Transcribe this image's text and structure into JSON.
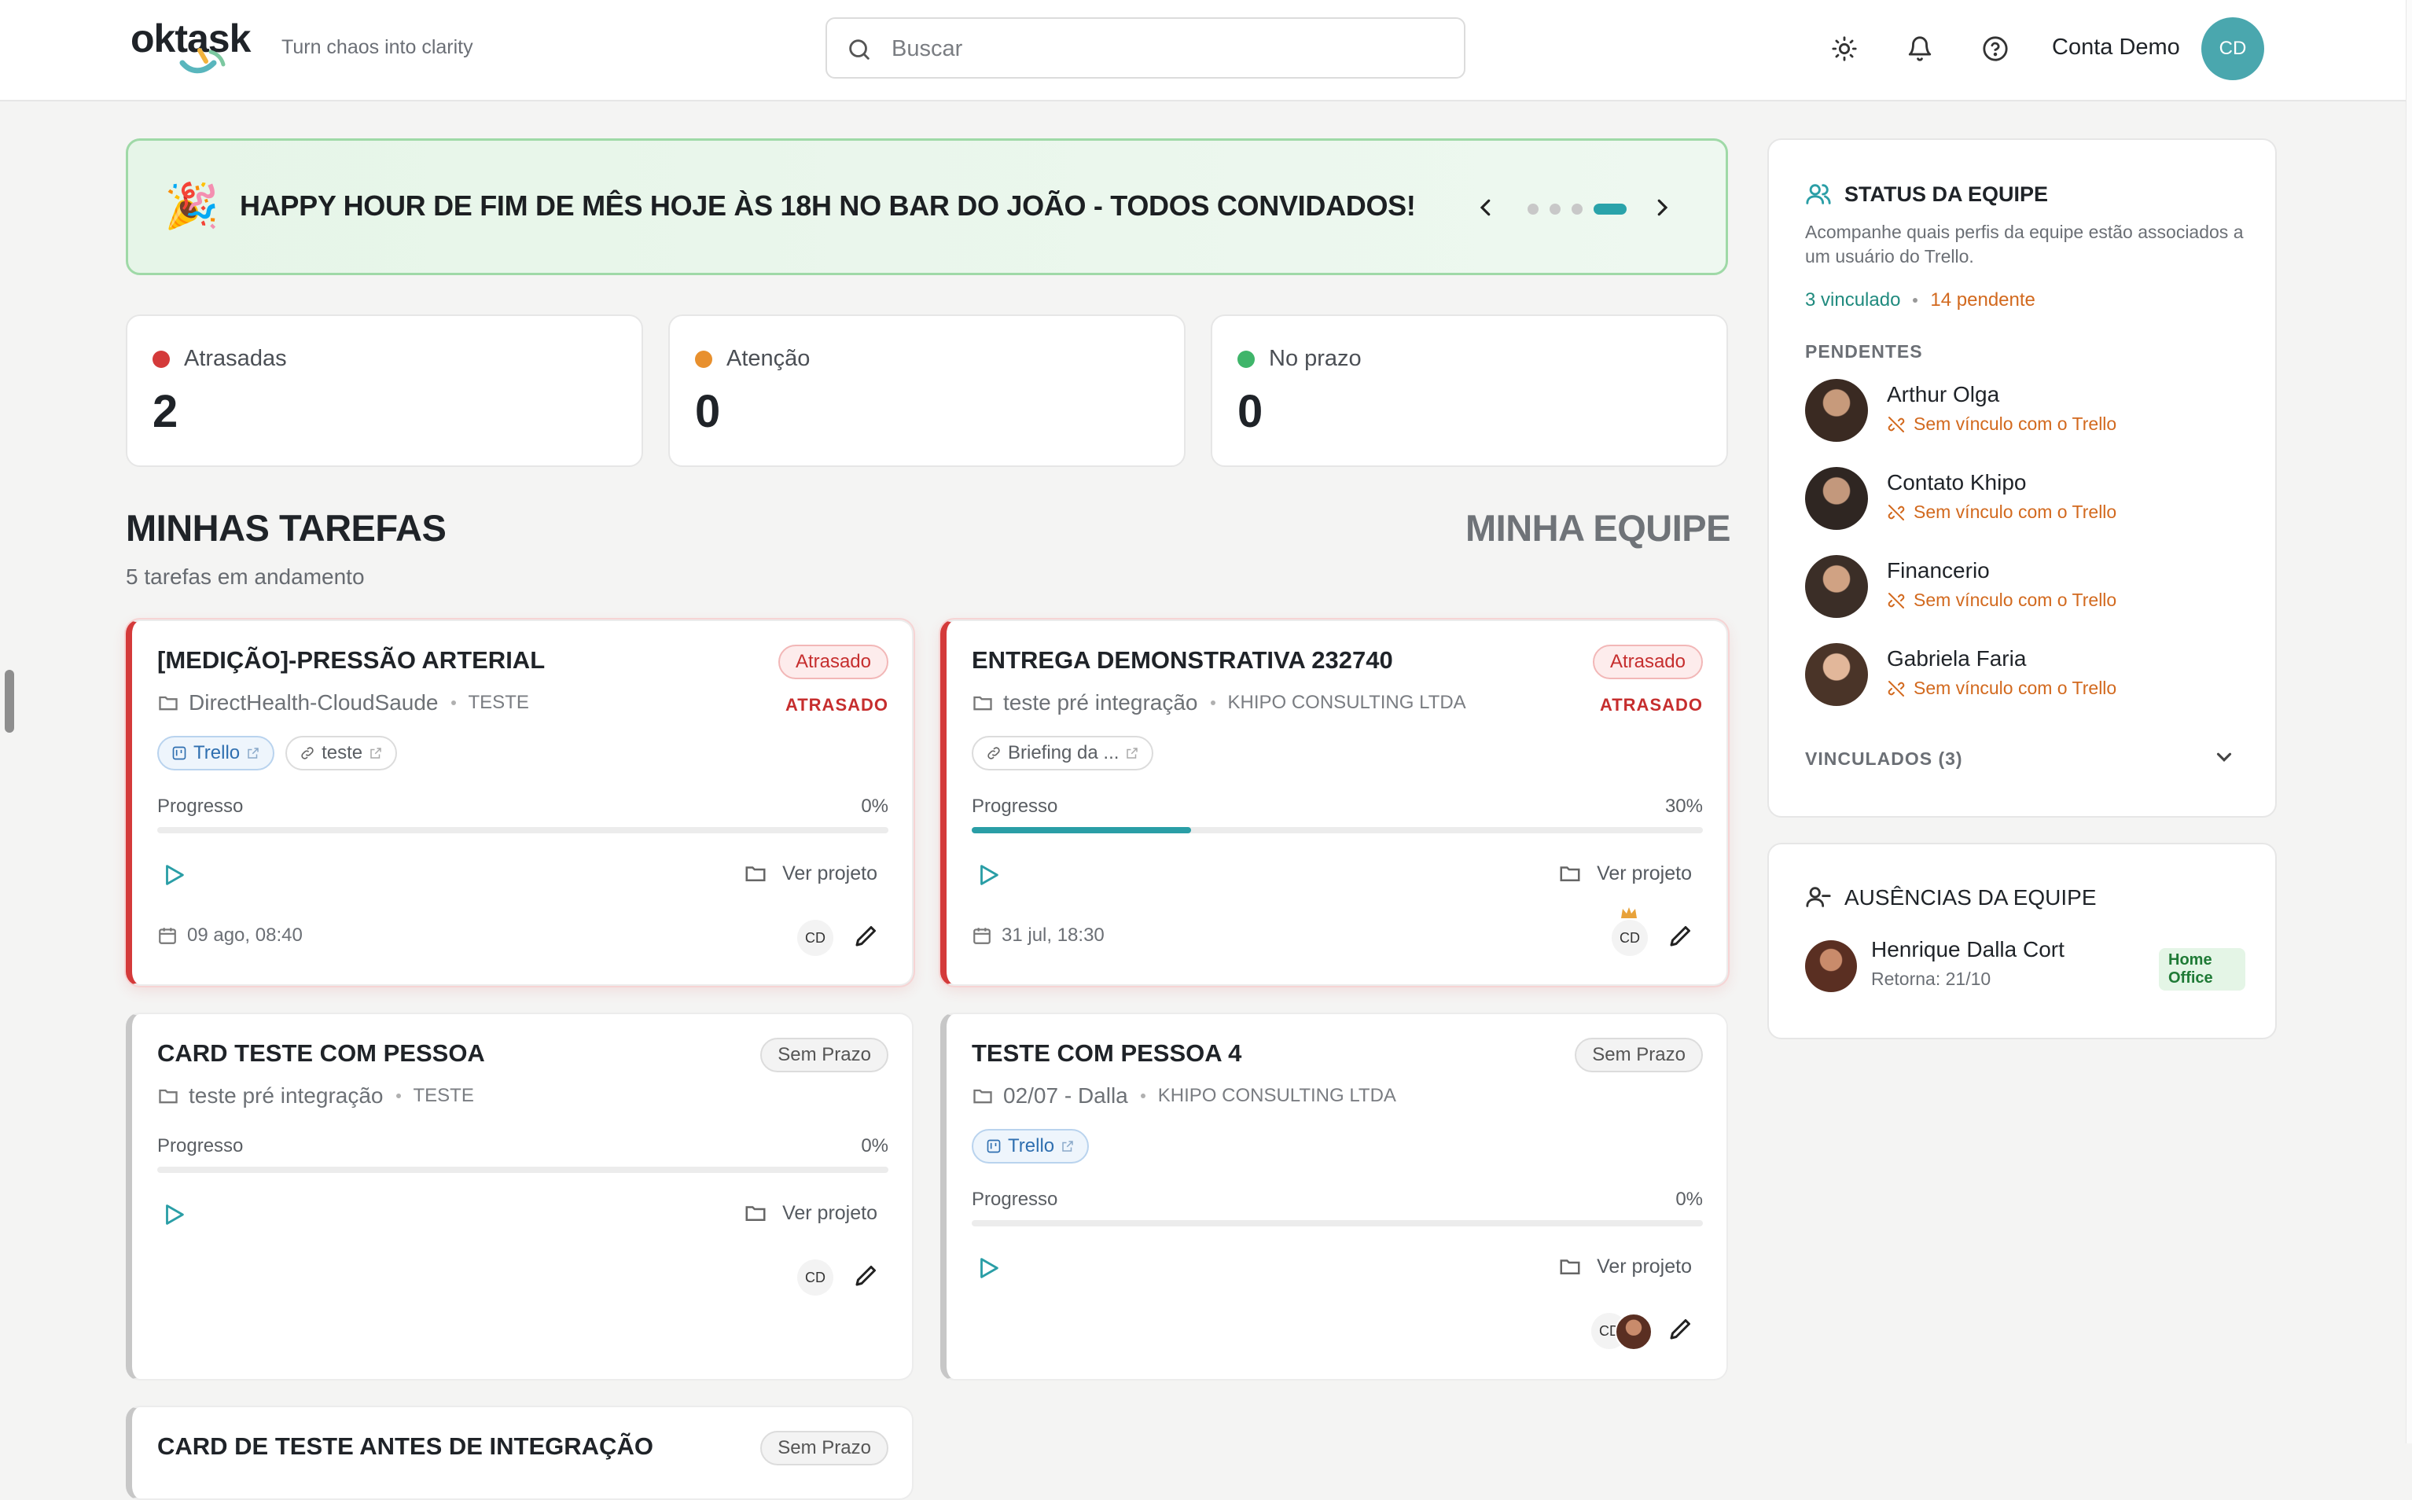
{
  "header": {
    "logo": "oktask",
    "tagline": "Turn chaos into clarity",
    "search_placeholder": "Buscar",
    "account_name": "Conta Demo",
    "account_initials": "CD",
    "icons": [
      "sun-icon",
      "bell-icon",
      "help-circle-icon"
    ]
  },
  "banner": {
    "emoji": "🎉",
    "message": "HAPPY HOUR DE FIM DE MÊS HOJE ÀS 18H NO BAR DO JOÃO - TODOS CONVIDADOS!",
    "slide_count": 4,
    "active_slide": 4
  },
  "stats": [
    {
      "label": "Atrasadas",
      "value": "2",
      "color": "#d43a3a"
    },
    {
      "label": "Atenção",
      "value": "0",
      "color": "#e8902e"
    },
    {
      "label": "No prazo",
      "value": "0",
      "color": "#3fb56a"
    }
  ],
  "tasks_section": {
    "title": "MINHAS TAREFAS",
    "subtitle": "5 tarefas em andamento",
    "team_tab": "MINHA EQUIPE"
  },
  "tasks": [
    {
      "title": "[MEDIÇÃO]-PRESSÃO ARTERIAL",
      "badge": "Atrasado",
      "late_caption": "ATRASADO",
      "project": "DirectHealth-CloudSaude",
      "client": "TESTE",
      "chips": [
        "Trello",
        "teste"
      ],
      "progress_label": "Progresso",
      "progress_text": "0%",
      "progress": 0,
      "action_label": "Ver projeto",
      "date": "09 ago, 08:40",
      "assignee": "CD"
    },
    {
      "title": "ENTREGA DEMONSTRATIVA 232740",
      "badge": "Atrasado",
      "late_caption": "ATRASADO",
      "project": "teste pré integração",
      "client": "KHIPO CONSULTING LTDA",
      "chips": [
        "Briefing da ..."
      ],
      "progress_label": "Progresso",
      "progress_text": "30%",
      "progress": 30,
      "action_label": "Ver projeto",
      "date": "31 jul, 18:30",
      "assignee": "CD"
    },
    {
      "title": "CARD TESTE COM PESSOA",
      "badge": "Sem Prazo",
      "project": "teste pré integração",
      "client": "TESTE",
      "progress_label": "Progresso",
      "progress_text": "0%",
      "progress": 0,
      "action_label": "Ver projeto",
      "assignee": "CD"
    },
    {
      "title": "TESTE COM PESSOA 4",
      "badge": "Sem Prazo",
      "project": "02/07 - Dalla",
      "client": "KHIPO CONSULTING LTDA",
      "chips": [
        "Trello"
      ],
      "progress_label": "Progresso",
      "progress_text": "0%",
      "progress": 0,
      "action_label": "Ver projeto",
      "assignee": "CD"
    },
    {
      "title": "CARD DE TESTE ANTES DE INTEGRAÇÃO",
      "badge": "Sem Prazo"
    }
  ],
  "team_status": {
    "title": "STATUS DA EQUIPE",
    "description": "Acompanhe quais perfis da equipe estão associados a um usuário do Trello.",
    "linked_text": "3 vinculado",
    "pending_text": "14 pendente",
    "pending_heading": "PENDENTES",
    "pending": [
      {
        "name": "Arthur Olga",
        "status": "Sem vínculo com o Trello"
      },
      {
        "name": "Contato Khipo",
        "status": "Sem vínculo com o Trello"
      },
      {
        "name": "Financerio",
        "status": "Sem vínculo com o Trello"
      },
      {
        "name": "Gabriela Faria",
        "status": "Sem vínculo com o Trello"
      }
    ],
    "linked_heading": "VINCULADOS (3)"
  },
  "absences": {
    "title": "AUSÊNCIAS DA EQUIPE",
    "items": [
      {
        "name": "Henrique Dalla Cort",
        "returns": "Retorna: 21/10",
        "badge": "Home Office"
      }
    ]
  }
}
